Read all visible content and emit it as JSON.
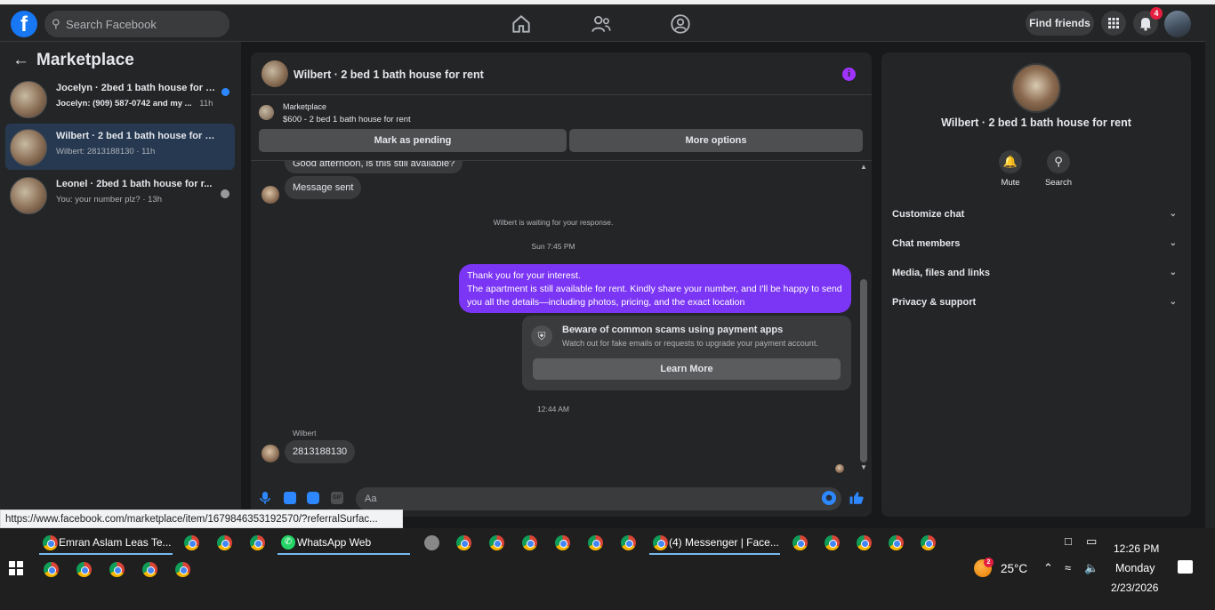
{
  "topbar": {
    "search_placeholder": "Search Facebook",
    "find_friends_label": "Find friends",
    "notifications_count": "4",
    "nav_icons": [
      "home-icon",
      "friends-icon",
      "groups-icon"
    ]
  },
  "sidebar": {
    "title": "Marketplace",
    "conversations": [
      {
        "title": "Jocelyn · 2bed 1 bath house for r...",
        "preview": "Jocelyn: (909) 587-0742 and my ...",
        "time": "11h",
        "unread": true
      },
      {
        "title": "Wilbert · 2 bed 1 bath house for rent",
        "preview": "Wilbert: 2813188130 · 11h",
        "time": "",
        "unread": false
      },
      {
        "title": "Leonel · 2bed 1 bath house for r...",
        "preview": "You: your number plz? · 13h",
        "time": "",
        "unread": false
      }
    ]
  },
  "chat": {
    "title": "Wilbert · 2 bed 1 bath house for rent",
    "marketplace_label": "Marketplace",
    "listing": "$600 - 2 bed 1 bath house for rent",
    "mark_pending_label": "Mark as pending",
    "more_options_label": "More options",
    "messages": {
      "partial_top": "Good afternoon, is this still available?",
      "auto_reply": "Message sent",
      "waiting_note": "Wilbert is waiting for your response.",
      "timestamp1": "Sun 7:45 PM",
      "outgoing_line1": "Thank you for your interest.",
      "outgoing_line2": "The apartment is still available for rent. Kindly share your number, and I'll be happy to send you all the details—including photos, pricing, and the exact location",
      "scam_title": "Beware of common scams using payment apps",
      "scam_body": "Watch out for fake emails or requests to upgrade your payment account.",
      "learn_more_label": "Learn More",
      "timestamp2": "12:44 AM",
      "sender_name": "Wilbert",
      "incoming_number": "2813188130"
    },
    "composer_placeholder": "Aa"
  },
  "details": {
    "title": "Wilbert · 2 bed 1 bath house for rent",
    "actions": [
      "Mute",
      "Search"
    ],
    "sections": [
      "Customize chat",
      "Chat members",
      "Media, files and links",
      "Privacy & support"
    ]
  },
  "status_url": "https://www.facebook.com/marketplace/item/1679846353192570/?referralSurfac...",
  "taskbar": {
    "tasks": [
      {
        "label": "Emran Aslam Leas Te..."
      },
      {
        "label": "WhatsApp Web"
      },
      {
        "label": "(4) Messenger | Face..."
      }
    ],
    "weather_badge": "2",
    "temperature": "25°C",
    "time": "12:26 PM",
    "day": "Monday",
    "date": "2/23/2026"
  },
  "colors": {
    "facebook_blue": "#1877f2",
    "outgoing_bubble": "#7b35f4",
    "unread_dot": "#2d88ff",
    "notification_badge": "#e41e3f"
  }
}
